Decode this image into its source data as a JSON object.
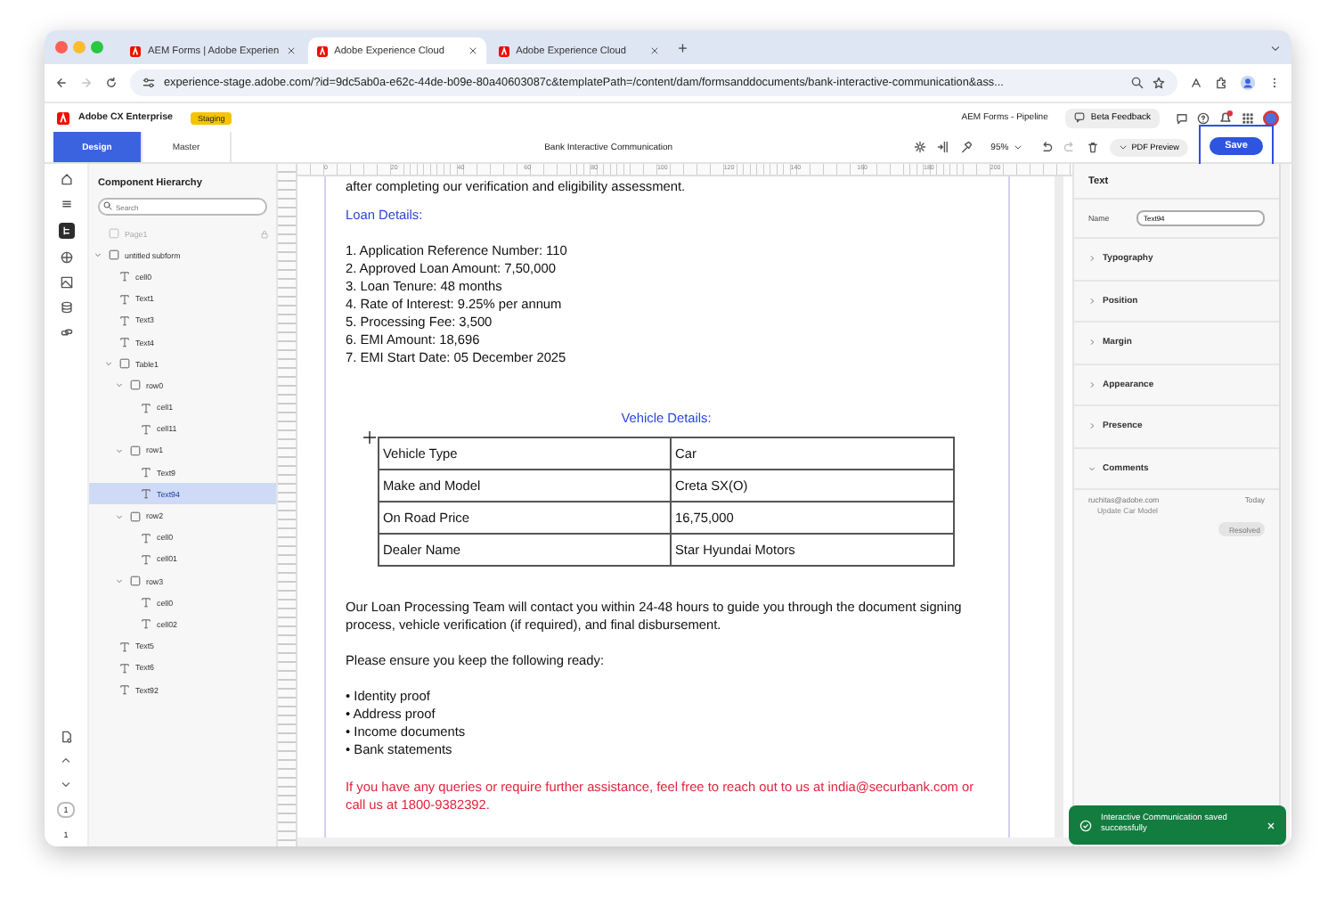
{
  "browser": {
    "tabs": [
      {
        "title": "AEM Forms | Adobe Experien",
        "selected": false
      },
      {
        "title": "Adobe Experience Cloud",
        "selected": true
      },
      {
        "title": "Adobe Experience Cloud",
        "selected": false
      }
    ],
    "new_tab": "+",
    "address": "experience-stage.adobe.com/?id=9dc5ab0a-e62c-44de-b09e-80a40603087c&templatePath=/content/dam/formsanddocuments/bank-interactive-communication&ass..."
  },
  "app_header": {
    "product": "Adobe CX Enterprise",
    "environment": "Staging",
    "program": "AEM Forms - Pipeline",
    "feedback_button": "Beta Feedback"
  },
  "toolbar": {
    "tabs": [
      {
        "label": "Design",
        "selected": true
      },
      {
        "label": "Master",
        "selected": false
      }
    ],
    "document_title": "Bank Interactive Communication",
    "zoom": "95%",
    "redo_disabled": true,
    "pdf_preview": "PDF Preview",
    "save": "Save"
  },
  "hierarchy": {
    "title": "Component Hierarchy",
    "search_placeholder": "Search",
    "items": [
      {
        "label": "Page1",
        "kind": "page",
        "disabled": true,
        "selected": false
      },
      {
        "label": "untitled subform",
        "kind": "container",
        "expanded": true,
        "disabled": false,
        "selected": false,
        "children": [
          {
            "label": "cell0",
            "kind": "text",
            "disabled": false,
            "selected": false
          },
          {
            "label": "Text1",
            "kind": "text",
            "disabled": false,
            "selected": false
          },
          {
            "label": "Text3",
            "kind": "text",
            "disabled": false,
            "selected": false
          },
          {
            "label": "Text4",
            "kind": "text",
            "disabled": false,
            "selected": false
          },
          {
            "label": "Table1",
            "kind": "container",
            "expanded": true,
            "disabled": false,
            "selected": false,
            "children": [
              {
                "label": "row0",
                "kind": "container",
                "expanded": true,
                "disabled": false,
                "selected": false,
                "children": [
                  {
                    "label": "cell1",
                    "kind": "text",
                    "disabled": false,
                    "selected": false
                  },
                  {
                    "label": "cell11",
                    "kind": "text",
                    "disabled": false,
                    "selected": false
                  }
                ]
              },
              {
                "label": "row1",
                "kind": "container",
                "expanded": true,
                "disabled": false,
                "selected": false,
                "children": [
                  {
                    "label": "Text9",
                    "kind": "text",
                    "disabled": false,
                    "selected": false
                  },
                  {
                    "label": "Text94",
                    "kind": "text",
                    "disabled": false,
                    "selected": true
                  }
                ]
              },
              {
                "label": "row2",
                "kind": "container",
                "expanded": true,
                "disabled": false,
                "selected": false,
                "children": [
                  {
                    "label": "cell0",
                    "kind": "text",
                    "disabled": false,
                    "selected": false
                  },
                  {
                    "label": "cell01",
                    "kind": "text",
                    "disabled": false,
                    "selected": false
                  }
                ]
              },
              {
                "label": "row3",
                "kind": "container",
                "expanded": true,
                "disabled": false,
                "selected": false,
                "children": [
                  {
                    "label": "cell0",
                    "kind": "text",
                    "disabled": false,
                    "selected": false
                  },
                  {
                    "label": "cell02",
                    "kind": "text",
                    "disabled": false,
                    "selected": false
                  }
                ]
              }
            ]
          },
          {
            "label": "Text5",
            "kind": "text",
            "disabled": false,
            "selected": false
          },
          {
            "label": "Text6",
            "kind": "text",
            "disabled": false,
            "selected": false
          },
          {
            "label": "Text92",
            "kind": "text",
            "disabled": false,
            "selected": false
          }
        ]
      }
    ]
  },
  "page_nav": {
    "current_page": "1",
    "page_count": "1"
  },
  "ruler_labels": [
    "0",
    "20",
    "40",
    "60",
    "80",
    "100",
    "120",
    "140",
    "160",
    "180",
    "200"
  ],
  "document": {
    "intro_line": "after completing our verification and eligibility assessment.",
    "loan_heading": "Loan Details:",
    "loan_items": [
      "1. Application Reference Number: 110",
      "2. Approved Loan Amount: 7,50,000",
      "3. Loan Tenure: 48 months",
      "4. Rate of Interest: 9.25% per annum",
      "5. Processing Fee: 3,500",
      "6. EMI Amount: 18,696",
      "7. EMI Start Date: 05 December 2025"
    ],
    "vehicle_heading": "Vehicle Details:",
    "vehicle_rows": [
      {
        "label": "Vehicle Type",
        "value": "Car"
      },
      {
        "label": "Make and Model",
        "value": "Creta SX(O)"
      },
      {
        "label": "On Road Price",
        "value": "16,75,000"
      },
      {
        "label": "Dealer Name",
        "value": "Star Hyundai Motors"
      }
    ],
    "closing_paragraph": "Our Loan Processing Team will contact you within 24-48 hours to guide you through the document signing process, vehicle verification (if required), and final disbursement.",
    "checklist_intro": "Please ensure you keep the following ready:",
    "checklist": [
      "• Identity proof",
      "• Address proof",
      "• Income documents",
      "• Bank statements"
    ],
    "contact_note": "If you have any queries or require further assistance, feel free to reach out to us at india@securbank.com or call us at 1800-9382392."
  },
  "properties": {
    "title": "Text",
    "name_label": "Name",
    "name_value": "Text94",
    "sections": [
      {
        "label": "Typography",
        "expanded": false
      },
      {
        "label": "Position",
        "expanded": false
      },
      {
        "label": "Margin",
        "expanded": false
      },
      {
        "label": "Appearance",
        "expanded": false
      },
      {
        "label": "Presence",
        "expanded": false
      },
      {
        "label": "Comments",
        "expanded": true
      }
    ],
    "comment": {
      "author": "ruchitas@adobe.com",
      "time": "Today",
      "text": "Update Car Model",
      "resolve_button": "Resolved",
      "resolve_disabled": true
    }
  },
  "toast": {
    "message": "Interactive Communication saved successfully"
  }
}
